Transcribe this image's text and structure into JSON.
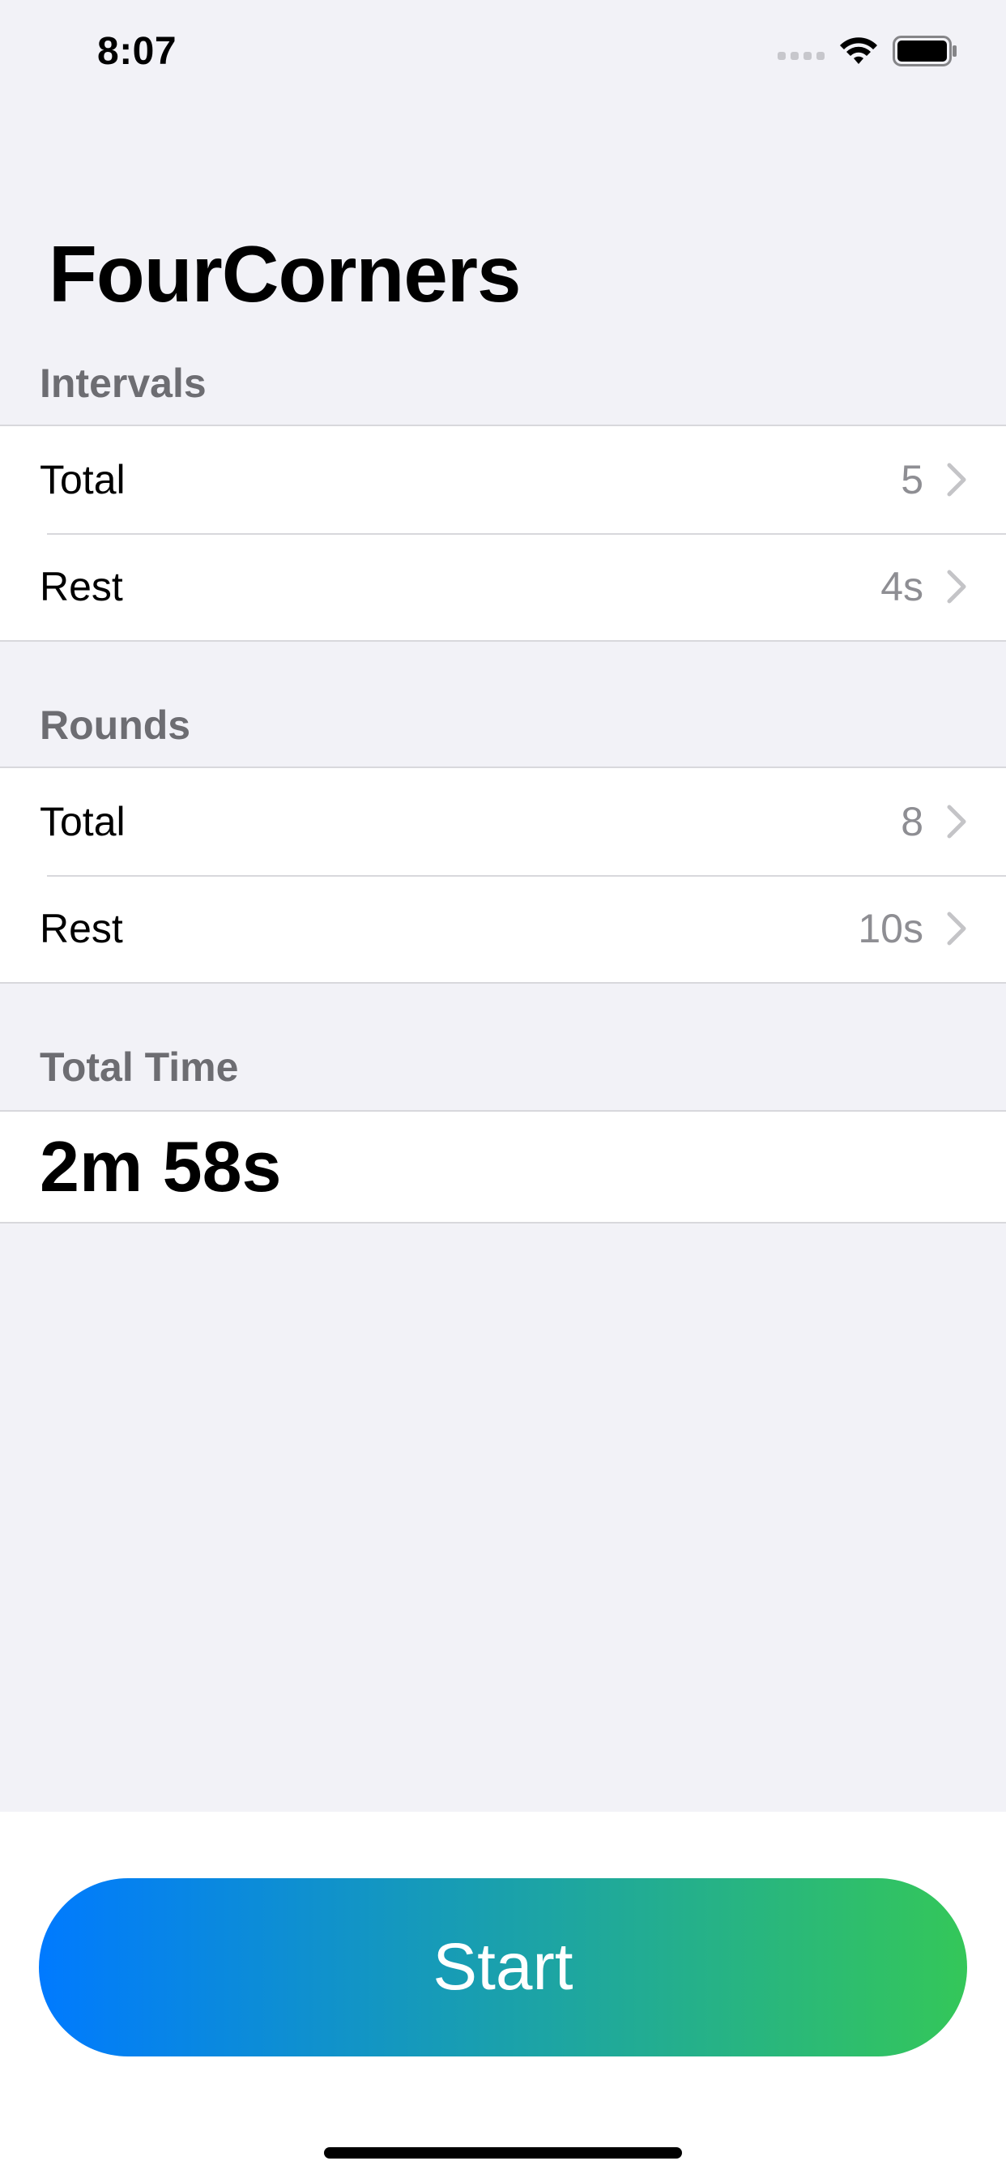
{
  "status_bar": {
    "time": "8:07",
    "icons": [
      "cellular-signal-icon",
      "wifi-icon",
      "battery-icon"
    ]
  },
  "page": {
    "title": "FourCorners"
  },
  "intervals": {
    "header": "Intervals",
    "rows": [
      {
        "label": "Total",
        "value": "5"
      },
      {
        "label": "Rest",
        "value": "4s"
      }
    ]
  },
  "rounds": {
    "header": "Rounds",
    "rows": [
      {
        "label": "Total",
        "value": "8"
      },
      {
        "label": "Rest",
        "value": "10s"
      }
    ]
  },
  "total_time": {
    "header": "Total Time",
    "value": "2m 58s"
  },
  "actions": {
    "start_label": "Start"
  },
  "colors": {
    "background": "#f2f2f7",
    "gradient_start": "#007aff",
    "gradient_end": "#34c759",
    "secondary_text": "#8e8e93",
    "section_header": "#6d6d72"
  }
}
